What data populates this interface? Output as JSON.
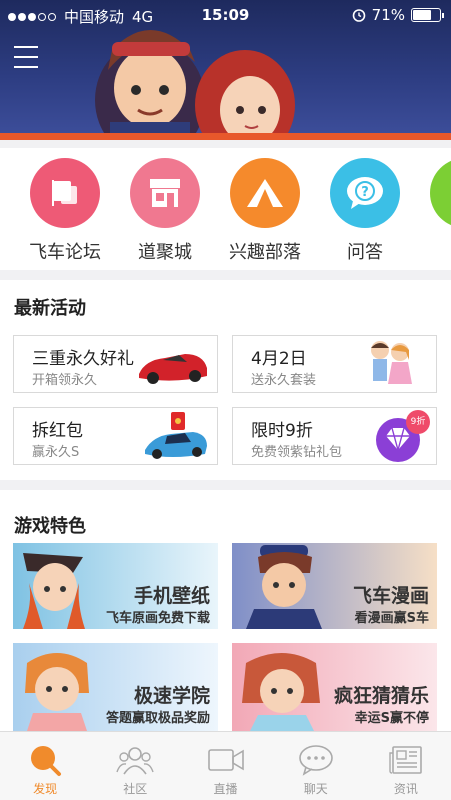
{
  "status_bar": {
    "carrier": "中国移动",
    "network": "4G",
    "time": "15:09",
    "battery": "71%",
    "battery_level": 0.71,
    "signal_bars": 3,
    "icons": [
      "alarm-icon",
      "battery-icon"
    ]
  },
  "header": {
    "menu_icon": "hamburger-menu-icon"
  },
  "quick_entries": [
    {
      "label": "飞车论坛",
      "icon": "forum-flag-icon",
      "color": "#ee5a76"
    },
    {
      "label": "道聚城",
      "icon": "shop-icon",
      "color": "#f07890"
    },
    {
      "label": "兴趣部落",
      "icon": "tent-icon",
      "color": "#f58a2c"
    },
    {
      "label": "问答",
      "icon": "question-bubble-icon",
      "color": "#3bbfe6"
    },
    {
      "label": "",
      "icon": "partial-green-icon",
      "color": "#7ccf34"
    }
  ],
  "activities": {
    "title": "最新活动",
    "items": [
      {
        "title": "三重永久好礼",
        "subtitle": "开箱领永久",
        "image": "red-race-car-image"
      },
      {
        "title": "4月2日",
        "subtitle": "送永久套装",
        "image": "couple-characters-image"
      },
      {
        "title": "拆红包",
        "subtitle": "赢永久S",
        "image": "red-packet-car-image"
      },
      {
        "title": "限时9折",
        "subtitle": "免费领紫钻礼包",
        "image": "purple-diamond-image",
        "badge": "9折"
      }
    ]
  },
  "features": {
    "title": "游戏特色",
    "items": [
      {
        "title": "手机壁纸",
        "subtitle": "飞车原画免费下载",
        "bg": "#a9d8ea"
      },
      {
        "title": "飞车漫画",
        "subtitle": "看漫画赢S车",
        "bg": "#f2cfb5"
      },
      {
        "title": "极速学院",
        "subtitle": "答题赢取极品奖励",
        "bg": "#cfe3f4"
      },
      {
        "title": "疯狂猜猜乐",
        "subtitle": "幸运S赢不停",
        "bg": "#f3c3cf"
      }
    ]
  },
  "tabbar": {
    "active_color": "#f08b2c",
    "items": [
      {
        "label": "发现",
        "icon": "discover-search-icon",
        "active": true
      },
      {
        "label": "社区",
        "icon": "community-people-icon",
        "active": false
      },
      {
        "label": "直播",
        "icon": "video-camera-icon",
        "active": false
      },
      {
        "label": "聊天",
        "icon": "chat-bubble-icon",
        "active": false
      },
      {
        "label": "资讯",
        "icon": "news-icon",
        "active": false
      }
    ]
  }
}
